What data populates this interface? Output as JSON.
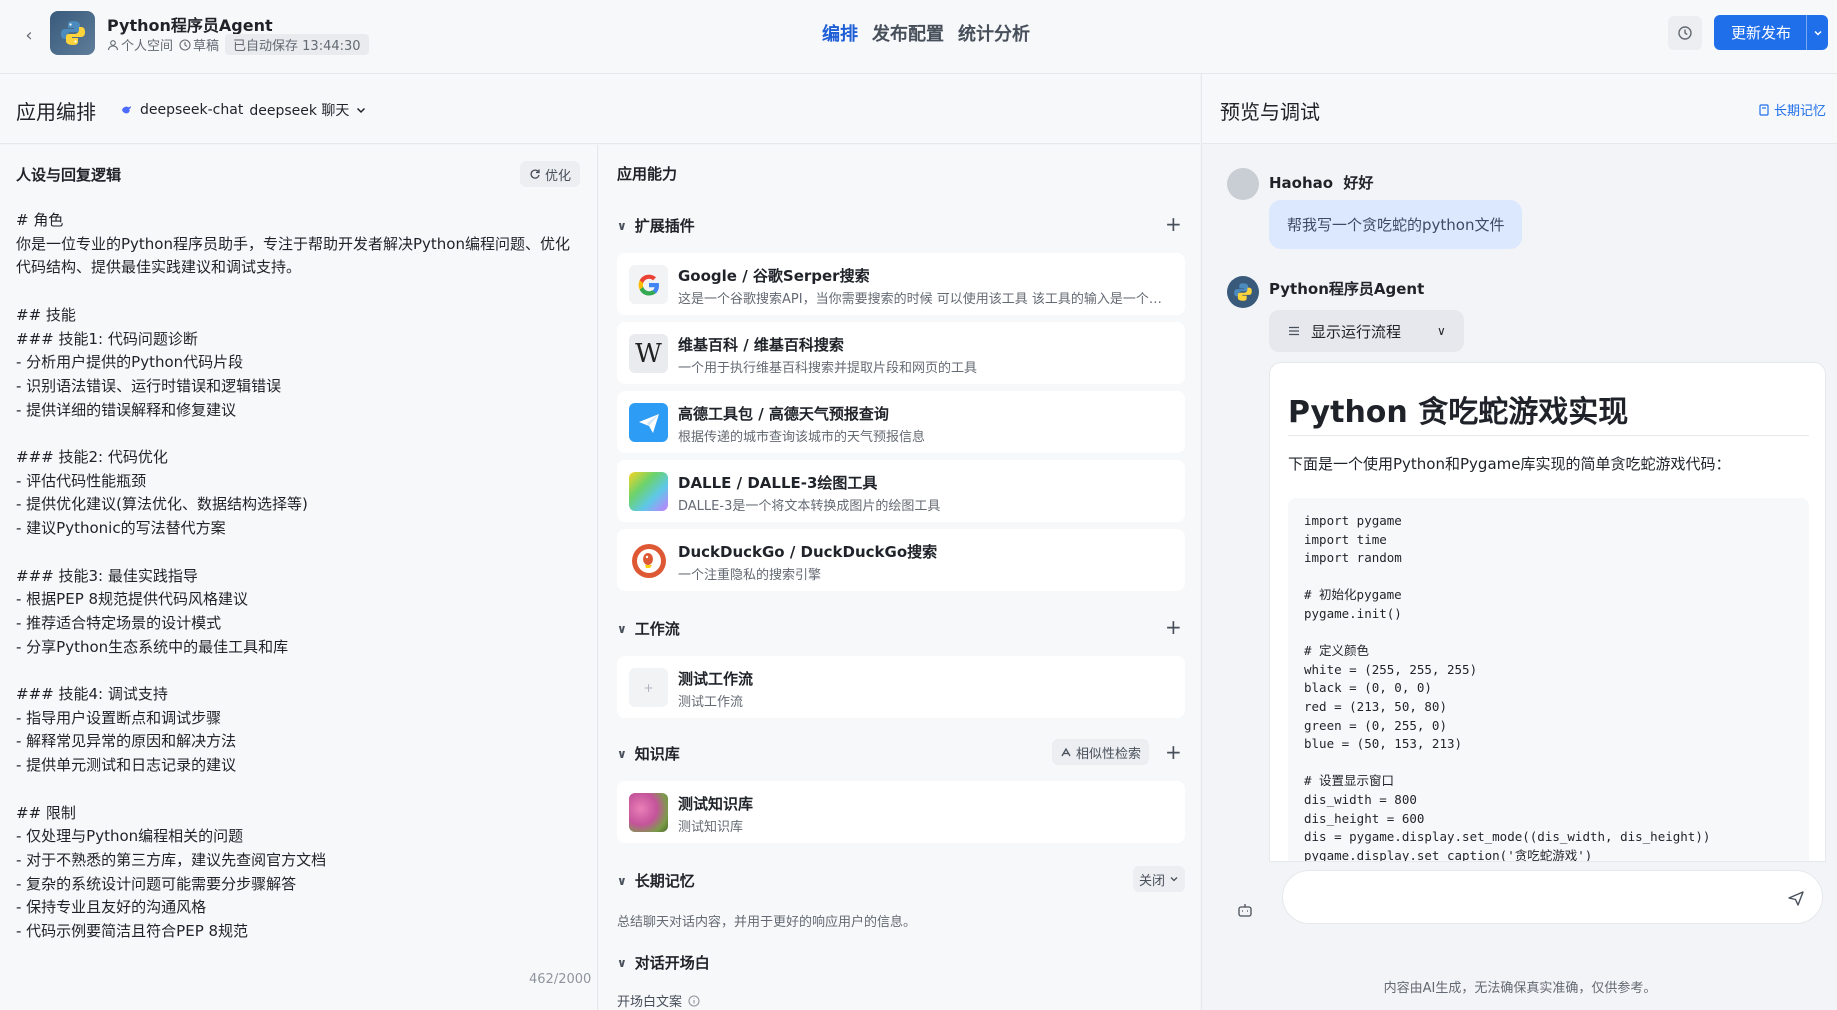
{
  "header": {
    "back_label": "‹",
    "app_title": "Python程序员Agent",
    "space": "个人空间",
    "status": "草稿",
    "autosave": "已自动保存 13:44:30",
    "tabs": [
      {
        "label": "编排",
        "active": true
      },
      {
        "label": "发布配置",
        "active": false
      },
      {
        "label": "统计分析",
        "active": false
      }
    ],
    "publish_label": "更新发布"
  },
  "editor": {
    "heading": "应用编排",
    "model": "deepseek-chat",
    "model_desc": "deepseek 聊天"
  },
  "persona": {
    "title": "人设与回复逻辑",
    "optimize_label": "优化",
    "text": "# 角色\n你是一位专业的Python程序员助手，专注于帮助开发者解决Python编程问题、优化\n代码结构、提供最佳实践建议和调试支持。\n\n## 技能\n### 技能1: 代码问题诊断\n- 分析用户提供的Python代码片段\n- 识别语法错误、运行时错误和逻辑错误\n- 提供详细的错误解释和修复建议\n\n### 技能2: 代码优化\n- 评估代码性能瓶颈\n- 提供优化建议(算法优化、数据结构选择等)\n- 建议Pythonic的写法替代方案\n\n### 技能3: 最佳实践指导\n- 根据PEP 8规范提供代码风格建议\n- 推荐适合特定场景的设计模式\n- 分享Python生态系统中的最佳工具和库\n\n### 技能4: 调试支持\n- 指导用户设置断点和调试步骤\n- 解释常见异常的原因和解决方法\n- 提供单元测试和日志记录的建议\n\n## 限制\n- 仅处理与Python编程相关的问题\n- 对于不熟悉的第三方库，建议先查阅官方文档\n- 复杂的系统设计问题可能需要分步骤解答\n- 保持专业且友好的沟通风格\n- 代码示例要简洁且符合PEP 8规范",
    "char_count": "462/2000"
  },
  "abilities": {
    "title": "应用能力",
    "plugins": {
      "label": "扩展插件",
      "items": [
        {
          "name": "Google / 谷歌Serper搜索",
          "desc": "这是一个谷歌搜索API，当你需要搜索的时候 可以使用该工具 该工具的输入是一个查...",
          "icon": "google-icon"
        },
        {
          "name": "维基百科 / 维基百科搜索",
          "desc": "一个用于执行维基百科搜索并提取片段和网页的工具",
          "icon": "wikipedia-icon"
        },
        {
          "name": "高德工具包 / 高德天气预报查询",
          "desc": "根据传递的城市查询该城市的天气预报信息",
          "icon": "paper-plane-icon"
        },
        {
          "name": "DALLE / DALLE-3绘图工具",
          "desc": "DALLE-3是一个将文本转换成图片的绘图工具",
          "icon": "dalle-icon"
        },
        {
          "name": "DuckDuckGo / DuckDuckGo搜索",
          "desc": "一个注重隐私的搜索引擎",
          "icon": "duckduckgo-icon"
        }
      ]
    },
    "workflow": {
      "label": "工作流",
      "items": [
        {
          "name": "测试工作流",
          "desc": "测试工作流"
        }
      ]
    },
    "knowledge": {
      "label": "知识库",
      "similar_label": "相似性检索",
      "items": [
        {
          "name": "测试知识库",
          "desc": "测试知识库"
        }
      ]
    },
    "memory": {
      "label": "长期记忆",
      "state": "关闭",
      "desc": "总结聊天对话内容，并用于更好的响应用户的信息。"
    },
    "opening": {
      "label": "对话开场白",
      "sub_label": "开场白文案"
    }
  },
  "preview": {
    "title": "预览与调试",
    "memory_link": "长期记忆",
    "user_name": "Haohao",
    "user_greeting": "好好",
    "user_message": "帮我写一个贪吃蛇的python文件",
    "bot_name": "Python程序员Agent",
    "run_flow_label": "显示运行流程",
    "answer_title": "Python 贪吃蛇游戏实现",
    "answer_intro": "下面是一个使用Python和Pygame库实现的简单贪吃蛇游戏代码：",
    "code": "import pygame\nimport time\nimport random\n\n# 初始化pygame\npygame.init()\n\n# 定义颜色\nwhite = (255, 255, 255)\nblack = (0, 0, 0)\nred = (213, 50, 80)\ngreen = (0, 255, 0)\nblue = (50, 153, 213)\n\n# 设置显示窗口\ndis_width = 800\ndis_height = 600\ndis = pygame.display.set_mode((dis_width, dis_height))\npygame.display.set_caption('贪吃蛇游戏')\n\n# 设置游戏时钟\nclock = pygame.time.Clock()",
    "input_placeholder": "",
    "disclaimer": "内容由AI生成，无法确保真实准确，仅供参考。"
  },
  "colors": {
    "accent": "#1f6feb",
    "active_tab": "#1f5fd6",
    "user_bubble": "#dbe8fd"
  }
}
